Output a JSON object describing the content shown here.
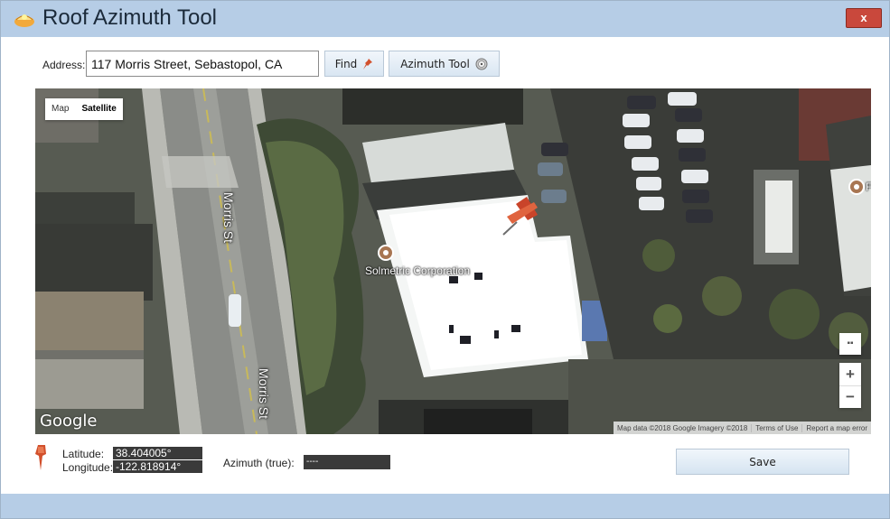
{
  "window": {
    "title": "Roof Azimuth Tool",
    "close_label": "x"
  },
  "toolbar": {
    "address_label": "Address:",
    "address_value": "117 Morris Street, Sebastopol, CA",
    "find_label": "Find",
    "azimuth_tool_label": "Azimuth Tool"
  },
  "map": {
    "type_map": "Map",
    "type_satellite": "Satellite",
    "logo": "Google",
    "street_label_1": "Morris St",
    "street_label_2": "Morris St",
    "place_label": "Solmetric Corporation",
    "place_label_edge": "F",
    "attribution": "Map data ©2018 Google Imagery ©2018",
    "terms": "Terms of Use",
    "report": "Report a map error",
    "zoom_in": "+",
    "zoom_out": "−"
  },
  "footer": {
    "latitude_label": "Latitude:",
    "latitude_value": "38.404005°",
    "longitude_label": "Longitude:",
    "longitude_value": "-122.818914°",
    "azimuth_label": "Azimuth (true):",
    "azimuth_value": "----",
    "save_label": "Save"
  },
  "colors": {
    "titlebar": "#b6cde6",
    "close": "#c9483c",
    "pin": "#d2502c"
  }
}
